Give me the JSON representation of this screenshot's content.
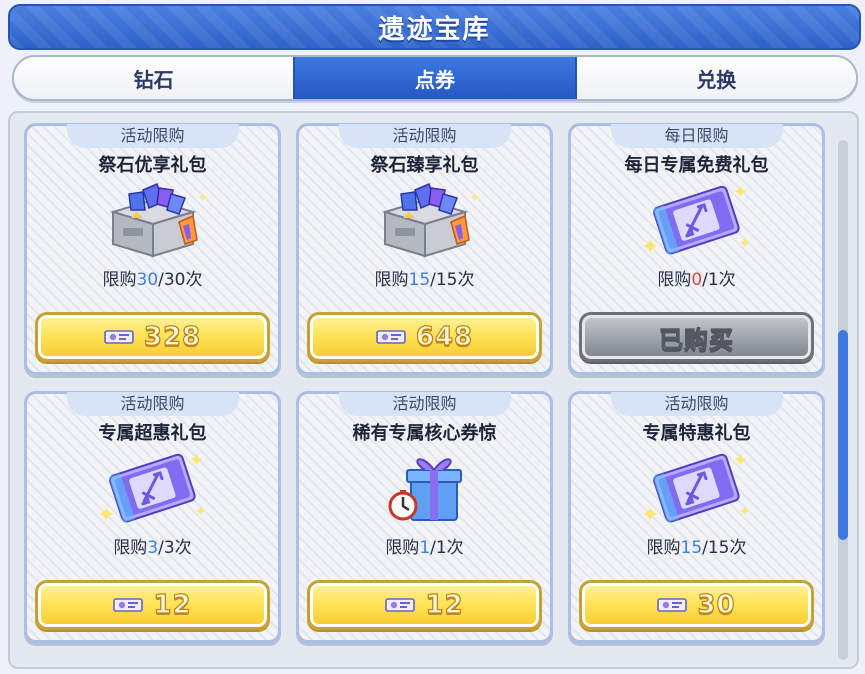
{
  "header": {
    "title": "遗迹宝库"
  },
  "tabs": [
    {
      "label": "钻石",
      "active": false
    },
    {
      "label": "点券",
      "active": true
    },
    {
      "label": "兑换",
      "active": false
    }
  ],
  "colors": {
    "accent_blue": "#2f62c8",
    "button_gold": "#ffe45a",
    "limit_used_blue": "#3e7ddf",
    "limit_used_red": "#e0463e"
  },
  "items": [
    {
      "tag": "活动限购",
      "name": "祭石优享礼包",
      "icon": "crystal-chest-icon",
      "limit_prefix": "限购",
      "used": "30",
      "total": "/30次",
      "price": "328",
      "currency_icon": "coupon-ticket-icon"
    },
    {
      "tag": "活动限购",
      "name": "祭石臻享礼包",
      "icon": "crystal-chest-icon",
      "limit_prefix": "限购",
      "used": "15",
      "total": "/15次",
      "price": "648",
      "currency_icon": "coupon-ticket-icon"
    },
    {
      "tag": "每日限购",
      "name": "每日专属免费礼包",
      "icon": "sword-ticket-icon",
      "limit_prefix": "限购",
      "used": "0",
      "total": "/1次",
      "price": "已购买",
      "currency_icon": ""
    },
    {
      "tag": "活动限购",
      "name": "专属超惠礼包",
      "icon": "sword-ticket-icon",
      "limit_prefix": "限购",
      "used": "3",
      "total": "/3次",
      "price": "12",
      "currency_icon": "coupon-ticket-icon"
    },
    {
      "tag": "活动限购",
      "name": "稀有专属核心券惊",
      "icon": "gift-box-icon",
      "limit_prefix": "限购",
      "used": "1",
      "total": "/1次",
      "price": "12",
      "currency_icon": "coupon-ticket-icon"
    },
    {
      "tag": "活动限购",
      "name": "专属特惠礼包",
      "icon": "sword-ticket-icon",
      "limit_prefix": "限购",
      "used": "15",
      "total": "/15次",
      "price": "30",
      "currency_icon": "coupon-ticket-icon"
    }
  ]
}
